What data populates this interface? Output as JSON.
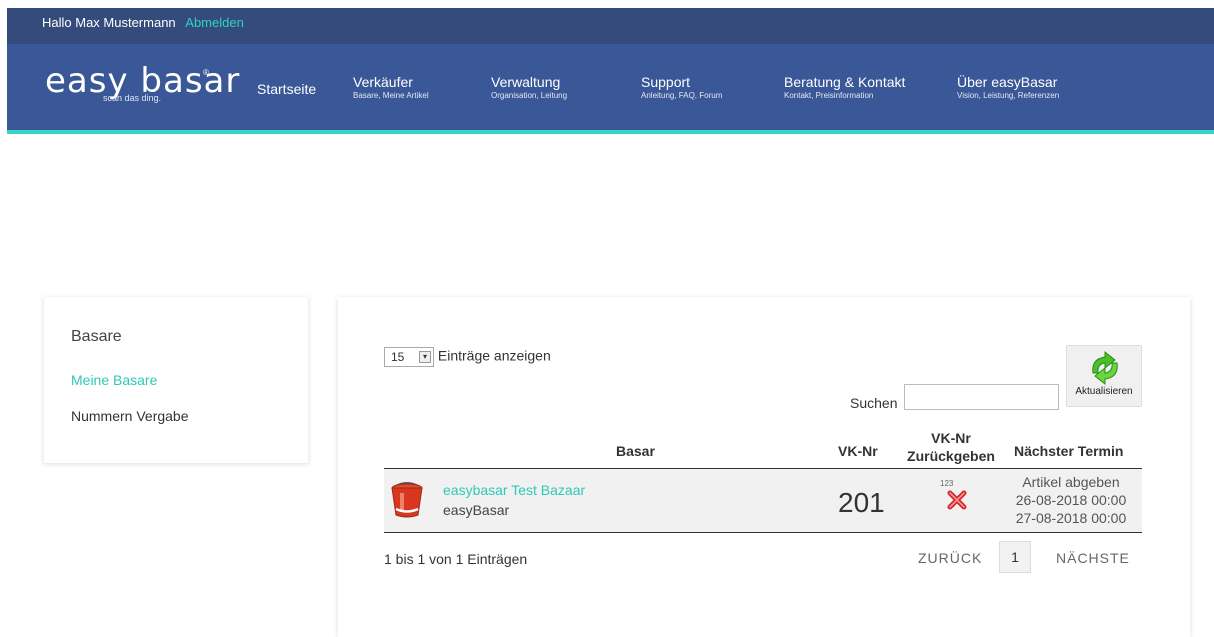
{
  "topbar": {
    "greeting": "Hallo Max Mustermann",
    "logout": "Abmelden"
  },
  "logo": {
    "word": "easy basar",
    "registered": "®",
    "tagline": "scan das ding."
  },
  "nav": [
    {
      "label": "Startseite",
      "sub": ""
    },
    {
      "label": "Verkäufer",
      "sub": "Basare, Meine Artikel"
    },
    {
      "label": "Verwaltung",
      "sub": "Organisation, Leitung"
    },
    {
      "label": "Support",
      "sub": "Anleitung, FAQ, Forum"
    },
    {
      "label": "Beratung & Kontakt",
      "sub": "Kontakt, Preisinformation"
    },
    {
      "label": "Über easyBasar",
      "sub": "Vision, Leistung, Referenzen"
    }
  ],
  "sidebar": {
    "title": "Basare",
    "items": [
      {
        "label": "Meine Basare",
        "active": true
      },
      {
        "label": "Nummern Vergabe",
        "active": false
      }
    ]
  },
  "table": {
    "length_value": "15",
    "length_label": "Einträge anzeigen",
    "refresh_label": "Aktualisieren",
    "search_label": "Suchen",
    "search_value": "",
    "headers": {
      "basar": "Basar",
      "vknr": "VK-Nr",
      "return": "VK-Nr\nZurückgeben",
      "next": "Nächster Termin"
    },
    "rows": [
      {
        "name": "easybasar Test Bazaar",
        "organizer": "easyBasar",
        "vknr": "201",
        "return_icon_label": "123",
        "next_line1": "Artikel abgeben",
        "next_line2": "26-08-2018 00:00",
        "next_line3": "27-08-2018 00:00"
      }
    ],
    "info": "1 bis 1 von 1 Einträgen",
    "prev": "ZURÜCK",
    "page": "1",
    "next": "NÄCHSTE"
  },
  "colors": {
    "nav_bg": "#3a5797",
    "topbar_bg": "#344b7c",
    "accent": "#2fc8b6"
  }
}
